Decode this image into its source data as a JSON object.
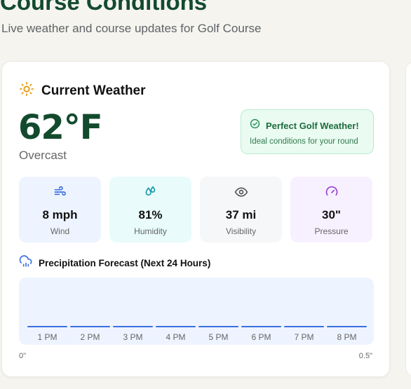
{
  "page": {
    "title": "Course Conditions",
    "subtitle": "Live weather and course updates for Golf Course"
  },
  "weather": {
    "header": "Current Weather",
    "temperature": "62°F",
    "condition": "Overcast",
    "alert": {
      "title": "Perfect Golf Weather!",
      "message": "Ideal conditions for your round"
    },
    "stats": [
      {
        "value": "8 mph",
        "label": "Wind",
        "icon": "wind-icon",
        "bg": "#eef4ff",
        "color": "#3b6fe0"
      },
      {
        "value": "81%",
        "label": "Humidity",
        "icon": "droplets-icon",
        "bg": "#e9fbfb",
        "color": "#1b9aa8"
      },
      {
        "value": "37 mi",
        "label": "Visibility",
        "icon": "eye-icon",
        "bg": "#f6f7f9",
        "color": "#555"
      },
      {
        "value": "30\"",
        "label": "Pressure",
        "icon": "gauge-icon",
        "bg": "#f7f1ff",
        "color": "#9b3fd6"
      }
    ]
  },
  "precipitation": {
    "title": "Precipitation Forecast (Next 24 Hours)",
    "hours": [
      "1 PM",
      "2 PM",
      "3 PM",
      "4 PM",
      "5 PM",
      "6 PM",
      "7 PM",
      "8 PM"
    ],
    "scale_min": "0\"",
    "scale_max": "0.5\""
  },
  "colors": {
    "brand_green": "#134a2e",
    "accent_blue": "#3b6fe0",
    "sun_orange": "#e69a10"
  }
}
